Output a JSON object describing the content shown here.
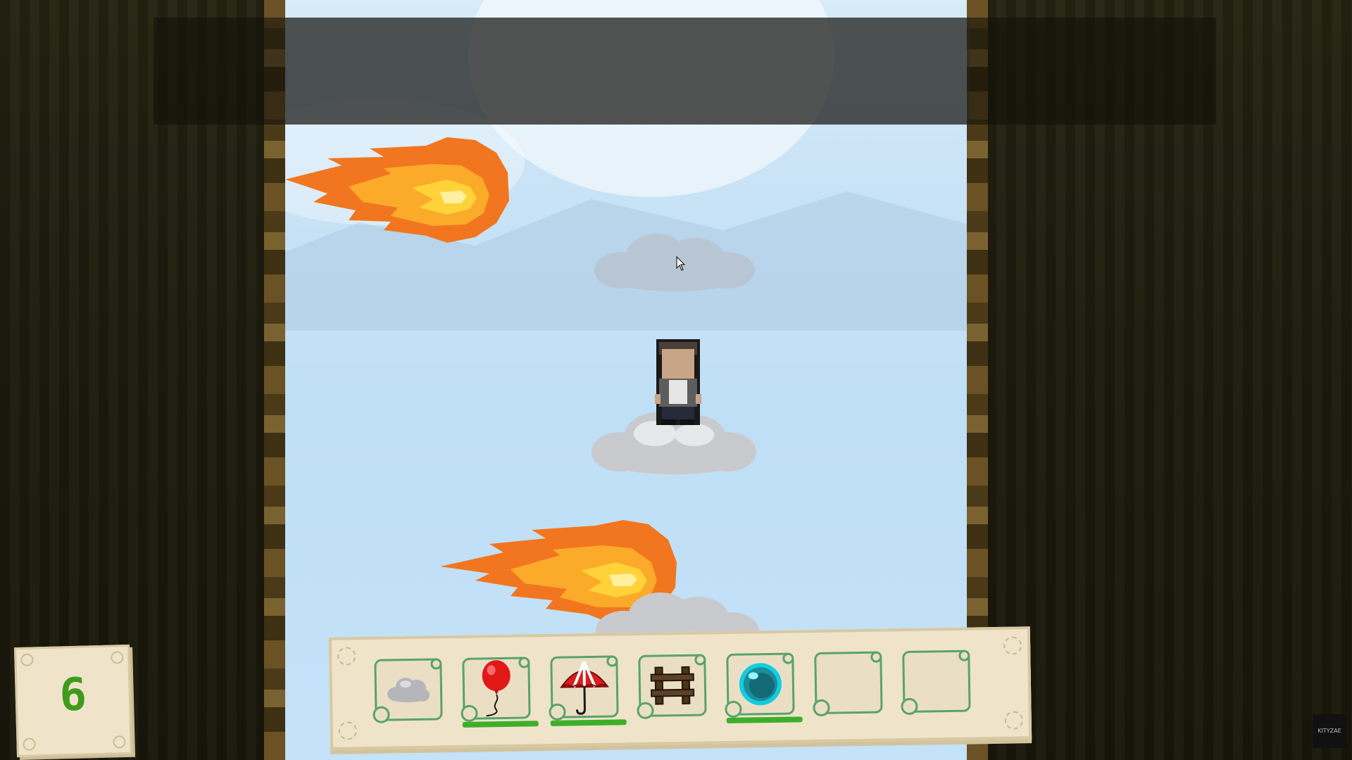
{
  "hud": {
    "score": "6",
    "watermark": "KITYZAE"
  },
  "inventory": {
    "slots": [
      {
        "item": "cloud",
        "icon": "cloud-icon",
        "has_charge": false,
        "charge": 0
      },
      {
        "item": "balloon",
        "icon": "balloon-icon",
        "has_charge": true,
        "charge": 1.0
      },
      {
        "item": "umbrella",
        "icon": "umbrella-icon",
        "has_charge": true,
        "charge": 1.0
      },
      {
        "item": "fence",
        "icon": "fence-icon",
        "has_charge": false,
        "charge": 0
      },
      {
        "item": "bubble",
        "icon": "bubble-icon",
        "has_charge": true,
        "charge": 1.0
      },
      {
        "item": "",
        "icon": "",
        "has_charge": false,
        "charge": 0
      },
      {
        "item": "",
        "icon": "",
        "has_charge": false,
        "charge": 0
      }
    ]
  },
  "colors": {
    "score_text": "#3f9b1c",
    "slot_border": "#5aa36b",
    "charge_bar": "#3fae2a",
    "parchment": "#efe4c9",
    "sky": "#c9e3f6",
    "fire_outer": "#f2761f",
    "fire_inner": "#ffc72b"
  }
}
